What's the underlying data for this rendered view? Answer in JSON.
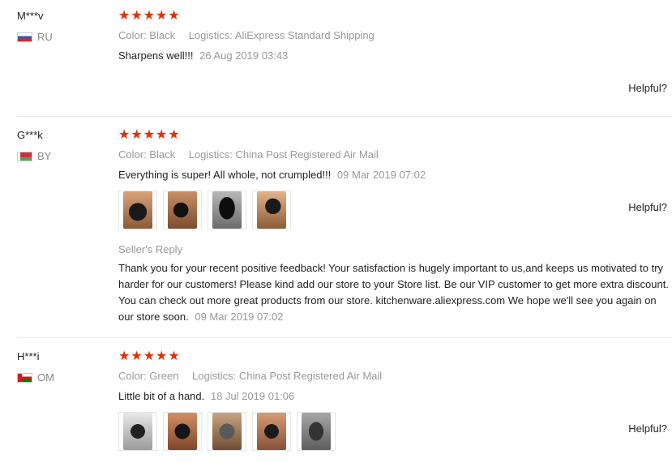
{
  "reviews": [
    {
      "user": "M***v",
      "country": "RU",
      "stars": "★★★★★",
      "rating": 5,
      "color": "Color: Black",
      "logistics": "Logistics: AliExpress Standard Shipping",
      "text": "Sharpens well!!!",
      "date": "26 Aug 2019 03:43",
      "helpful": "Helpful?"
    },
    {
      "user": "G***k",
      "country": "BY",
      "stars": "★★★★★",
      "rating": 5,
      "color": "Color: Black",
      "logistics": "Logistics: China Post Registered Air Mail",
      "text": "Everything is super! All whole, not crumpled!!!",
      "date": "09 Mar 2019 07:02",
      "helpful": "Helpful?",
      "photo_count": 4,
      "seller_reply": {
        "label": "Seller's Reply",
        "text": "Thank you for your recent positive feedback! Your satisfaction is hugely important to us,and keeps us motivated to try harder for our customers! Please kind add our store to your Store list. Be our VIP customer to get more extra discount. You can check out more great products from our store. kitchenware.aliexpress.com We hope we'll see you again on our store soon.",
        "date": "09 Mar 2019 07:02"
      }
    },
    {
      "user": "H***i",
      "country": "OM",
      "stars": "★★★★★",
      "rating": 5,
      "color": "Color: Green",
      "logistics": "Logistics: China Post Registered Air Mail",
      "text": "Little bit of a hand.",
      "date": "18 Jul 2019 01:06",
      "helpful": "Helpful?",
      "photo_count": 5
    }
  ],
  "colors": {
    "star": "#e62e04",
    "muted": "#999999",
    "divider": "#e6e6e6"
  }
}
